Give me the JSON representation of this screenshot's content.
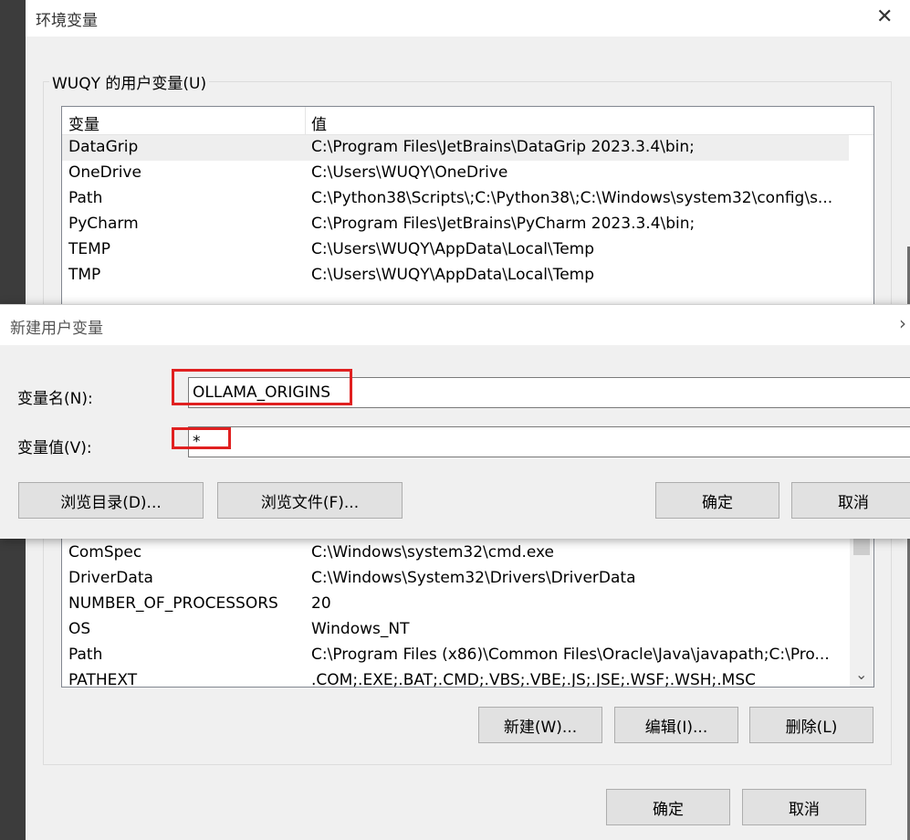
{
  "env_dialog": {
    "title": "环境变量",
    "user_group_label": "WUQY 的用户变量(U)",
    "columns": [
      "变量",
      "值"
    ],
    "user_vars": [
      {
        "name": "DataGrip",
        "value": "C:\\Program Files\\JetBrains\\DataGrip 2023.3.4\\bin;"
      },
      {
        "name": "OneDrive",
        "value": "C:\\Users\\WUQY\\OneDrive"
      },
      {
        "name": "Path",
        "value": "C:\\Python38\\Scripts\\;C:\\Python38\\;C:\\Windows\\system32\\config\\s..."
      },
      {
        "name": "PyCharm",
        "value": "C:\\Program Files\\JetBrains\\PyCharm 2023.3.4\\bin;"
      },
      {
        "name": "TEMP",
        "value": "C:\\Users\\WUQY\\AppData\\Local\\Temp"
      },
      {
        "name": "TMP",
        "value": "C:\\Users\\WUQY\\AppData\\Local\\Temp"
      }
    ],
    "system_vars": [
      {
        "name": "ComSpec",
        "value": "C:\\Windows\\system32\\cmd.exe"
      },
      {
        "name": "DriverData",
        "value": "C:\\Windows\\System32\\Drivers\\DriverData"
      },
      {
        "name": "NUMBER_OF_PROCESSORS",
        "value": "20"
      },
      {
        "name": "OS",
        "value": "Windows_NT"
      },
      {
        "name": "Path",
        "value": "C:\\Program Files (x86)\\Common Files\\Oracle\\Java\\javapath;C:\\Pro..."
      },
      {
        "name": "PATHEXT",
        "value": ".COM;.EXE;.BAT;.CMD;.VBS;.VBE;.JS;.JSE;.WSF;.WSH;.MSC"
      }
    ],
    "buttons": {
      "new": "新建(W)...",
      "edit": "编辑(I)...",
      "delete": "删除(L)",
      "ok": "确定",
      "cancel": "取消"
    }
  },
  "new_var_dialog": {
    "title": "新建用户变量",
    "name_label": "变量名(N):",
    "value_label": "变量值(V):",
    "name_value": "OLLAMA_ORIGINS",
    "value_value": "*",
    "buttons": {
      "browse_dir": "浏览目录(D)...",
      "browse_file": "浏览文件(F)...",
      "ok": "确定",
      "cancel": "取消"
    }
  },
  "colors": {
    "highlight": "#e02020",
    "selected_row": "#eeeeee"
  },
  "icons": {
    "close": "close-icon",
    "scroll_down": "chevron-down-icon"
  }
}
